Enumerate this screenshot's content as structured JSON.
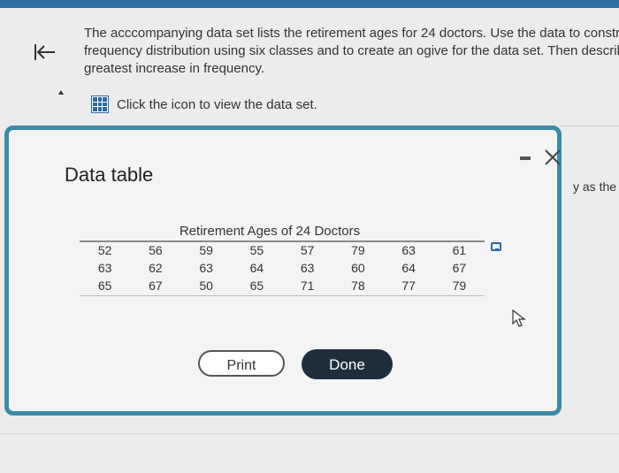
{
  "question": {
    "lines": [
      "The acccompanying data set lists the retirement ages for 24 doctors. Use the data to constru",
      "frequency distribution using six classes and to create an ogive for the data set. Then describe",
      "greatest increase in frequency."
    ],
    "data_link_label": "Click the icon to view the data set."
  },
  "side_fragment": "y as the",
  "dialog": {
    "title": "Data table",
    "table_caption": "Retirement Ages of 24 Doctors",
    "rows": [
      [
        "52",
        "56",
        "59",
        "55",
        "57",
        "79",
        "63",
        "61"
      ],
      [
        "63",
        "62",
        "63",
        "64",
        "63",
        "60",
        "64",
        "67"
      ],
      [
        "65",
        "67",
        "50",
        "65",
        "71",
        "78",
        "77",
        "79"
      ]
    ],
    "print_label": "Print",
    "done_label": "Done"
  },
  "icons": {
    "back": "back-to-start-icon",
    "data": "table-grid-icon",
    "minimize": "minimize-icon",
    "close": "close-icon",
    "copy": "copy-data-icon",
    "cursor": "mouse-pointer-icon"
  },
  "colors": {
    "accent": "#3d8aa8",
    "link_blue": "#2c6aa0",
    "done_bg": "#1f2e3d"
  }
}
